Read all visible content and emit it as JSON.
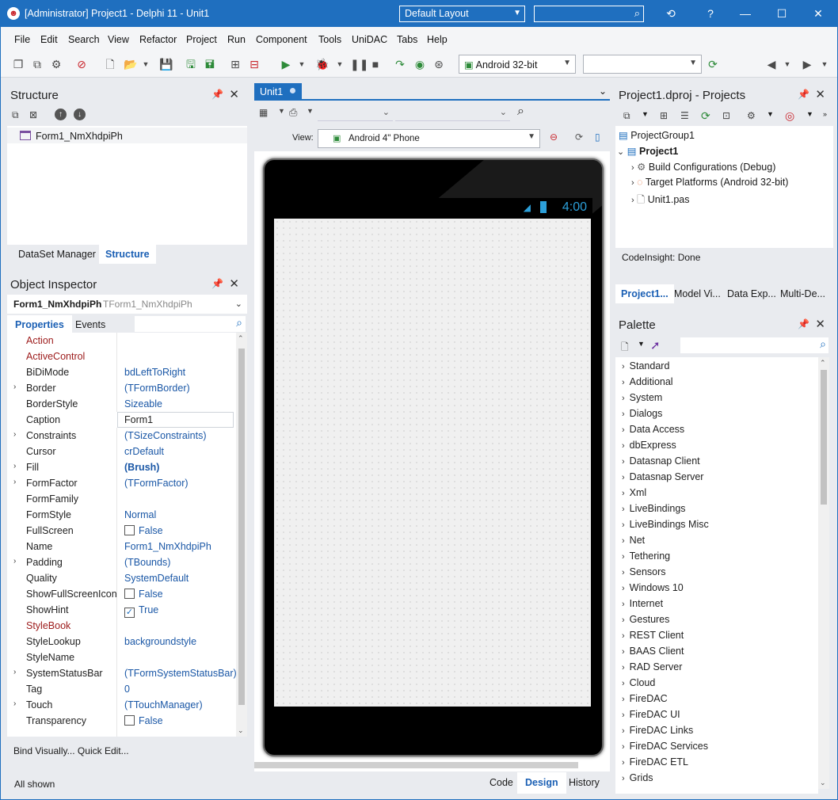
{
  "titlebar": {
    "title": "[Administrator] Project1 - Delphi 11 - Unit1",
    "layout": "Default Layout",
    "help": "?"
  },
  "menu": [
    "File",
    "Edit",
    "Search",
    "View",
    "Refactor",
    "Project",
    "Run",
    "Component",
    "Tools",
    "UniDAC",
    "Tabs",
    "Help"
  ],
  "toolbar": {
    "platform": "Android 32-bit",
    "target": ""
  },
  "structure": {
    "title": "Structure",
    "item": "Form1_NmXhdpiPh",
    "tabs": [
      "DataSet Manager",
      "Structure"
    ]
  },
  "designer": {
    "tab": "Unit1",
    "view_label": "View:",
    "view_value": "Android 4\" Phone",
    "clock": "4:00",
    "bottom_tabs": [
      "Code",
      "Design",
      "History"
    ]
  },
  "object_inspector": {
    "title": "Object Inspector",
    "object_name": "Form1_NmXhdpiPh",
    "object_type": "TForm1_NmXhdpiPh",
    "tabs": [
      "Properties",
      "Events"
    ],
    "rows": [
      {
        "name": "Action",
        "value": "",
        "red": true
      },
      {
        "name": "ActiveControl",
        "value": "",
        "red": true
      },
      {
        "name": "BiDiMode",
        "value": "bdLeftToRight"
      },
      {
        "name": "Border",
        "value": "(TFormBorder)",
        "expand": true
      },
      {
        "name": "BorderStyle",
        "value": "Sizeable"
      },
      {
        "name": "Caption",
        "value": "Form1",
        "edit": true
      },
      {
        "name": "Constraints",
        "value": "(TSizeConstraints)",
        "expand": true
      },
      {
        "name": "Cursor",
        "value": "crDefault"
      },
      {
        "name": "Fill",
        "value": "(Brush)",
        "expand": true,
        "bold": true
      },
      {
        "name": "FormFactor",
        "value": "(TFormFactor)",
        "expand": true
      },
      {
        "name": "FormFamily",
        "value": ""
      },
      {
        "name": "FormStyle",
        "value": "Normal"
      },
      {
        "name": "FullScreen",
        "value": "False",
        "check": false
      },
      {
        "name": "Name",
        "value": "Form1_NmXhdpiPh"
      },
      {
        "name": "Padding",
        "value": "(TBounds)",
        "expand": true
      },
      {
        "name": "Quality",
        "value": "SystemDefault"
      },
      {
        "name": "ShowFullScreenIcon",
        "value": "False",
        "check": false
      },
      {
        "name": "ShowHint",
        "value": "True",
        "check": true
      },
      {
        "name": "StyleBook",
        "value": "",
        "red": true
      },
      {
        "name": "StyleLookup",
        "value": "backgroundstyle"
      },
      {
        "name": "StyleName",
        "value": ""
      },
      {
        "name": "SystemStatusBar",
        "value": "(TFormSystemStatusBar)",
        "expand": true
      },
      {
        "name": "Tag",
        "value": "0"
      },
      {
        "name": "Touch",
        "value": "(TTouchManager)",
        "expand": true
      },
      {
        "name": "Transparency",
        "value": "False",
        "check": false
      }
    ],
    "links": "Bind Visually...  Quick Edit...",
    "status": "All shown"
  },
  "projects": {
    "title": "Project1.dproj - Projects",
    "group": "ProjectGroup1",
    "project": "Project1",
    "children": [
      "Build Configurations (Debug)",
      "Target Platforms (Android 32-bit)",
      "Unit1.pas"
    ],
    "status": "CodeInsight: Done",
    "tabs": [
      "Project1...",
      "Model Vi...",
      "Data Exp...",
      "Multi-De..."
    ]
  },
  "palette": {
    "title": "Palette",
    "items": [
      "Standard",
      "Additional",
      "System",
      "Dialogs",
      "Data Access",
      "dbExpress",
      "Datasnap Client",
      "Datasnap Server",
      "Xml",
      "LiveBindings",
      "LiveBindings Misc",
      "Net",
      "Tethering",
      "Sensors",
      "Windows 10",
      "Internet",
      "Gestures",
      "REST Client",
      "BAAS Client",
      "RAD Server",
      "Cloud",
      "FireDAC",
      "FireDAC UI",
      "FireDAC Links",
      "FireDAC Services",
      "FireDAC ETL",
      "Grids"
    ]
  },
  "colors": {
    "accent": "#1f6fbf",
    "selected_tab": "#1a5fb4",
    "red_prop": "#9c1a1a"
  }
}
